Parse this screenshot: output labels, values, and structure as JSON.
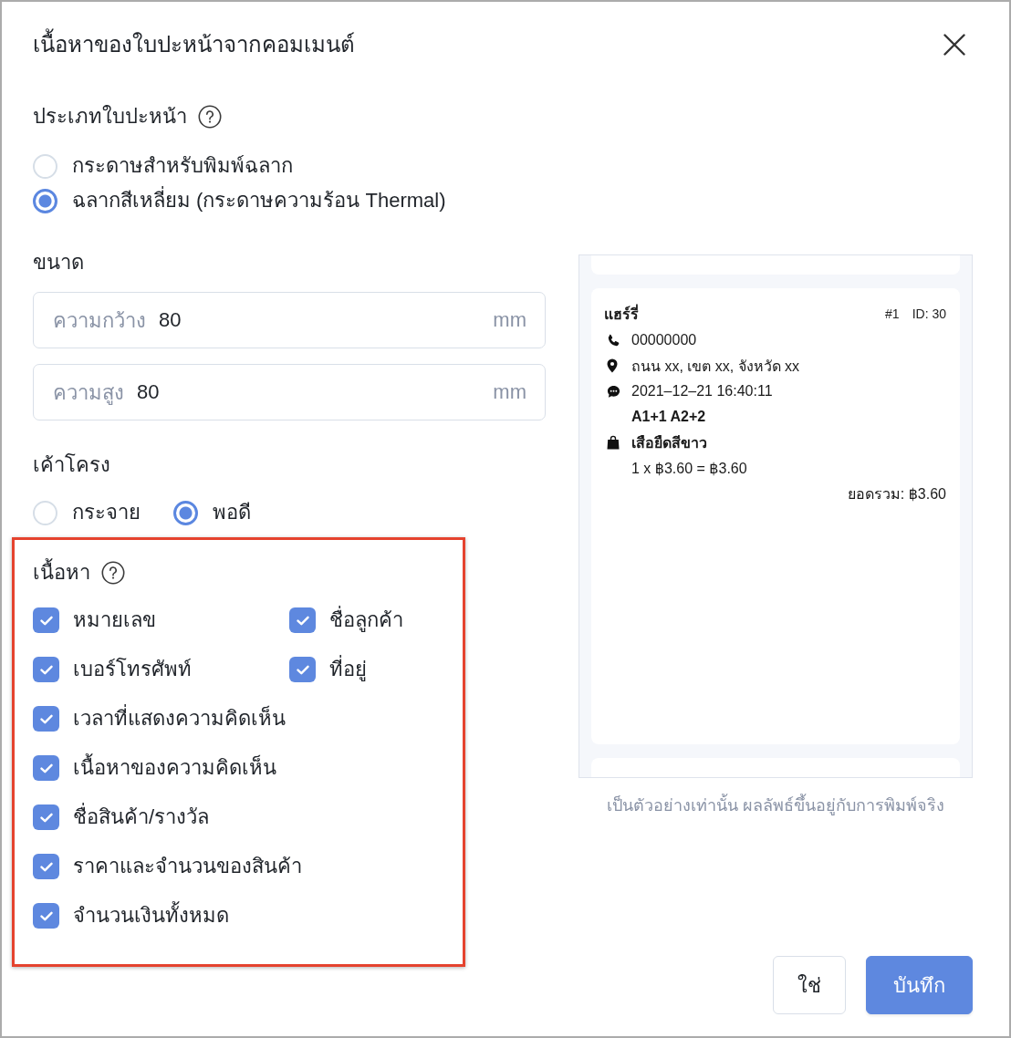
{
  "dialog": {
    "title": "เนื้อหาของใบปะหน้าจากคอมเมนต์"
  },
  "paper_type": {
    "label": "ประเภทใบปะหน้า",
    "help": true,
    "options": [
      {
        "label": "กระดาษสำหรับพิมพ์ฉลาก",
        "selected": false
      },
      {
        "label": "ฉลากสีเหลี่ยม (กระดาษความร้อน Thermal)",
        "selected": true
      }
    ]
  },
  "size": {
    "label": "ขนาด",
    "help": false,
    "fields": [
      {
        "label": "ความกว้าง",
        "value": "80",
        "unit": "mm"
      },
      {
        "label": "ความสูง",
        "value": "80",
        "unit": "mm"
      }
    ]
  },
  "layout": {
    "label": "เค้าโครง",
    "help": false,
    "options": [
      {
        "label": "กระจาย",
        "selected": false
      },
      {
        "label": "พอดี",
        "selected": true
      }
    ]
  },
  "content": {
    "label": "เนื้อหา",
    "help": true,
    "highlighted": true,
    "rows": [
      [
        {
          "label": "หมายเลข",
          "checked": true
        },
        {
          "label": "ชื่อลูกค้า",
          "checked": true
        }
      ],
      [
        {
          "label": "เบอร์โทรศัพท์",
          "checked": true
        },
        {
          "label": "ที่อยู่",
          "checked": true
        }
      ],
      [
        {
          "label": "เวลาที่แสดงความคิดเห็น",
          "checked": true
        }
      ],
      [
        {
          "label": "เนื้อหาของความคิดเห็น",
          "checked": true
        }
      ],
      [
        {
          "label": "ชื่อสินค้า/รางวัล",
          "checked": true
        }
      ],
      [
        {
          "label": "ราคาและจำนวนของสินค้า",
          "checked": true
        }
      ],
      [
        {
          "label": "จำนวนเงินทั้งหมด",
          "checked": true
        }
      ]
    ]
  },
  "preview": {
    "card": {
      "name": "แฮร์รี่",
      "number": "#1",
      "id": "ID: 30",
      "lines": [
        {
          "kind": "phone",
          "text": "00000000"
        },
        {
          "kind": "address",
          "text": "ถนน xx, เขต xx, จังหวัด xx"
        },
        {
          "kind": "comment_time",
          "text": "2021–12–21 16:40:11"
        },
        {
          "kind": "comment",
          "text": "A1+1 A2+2"
        },
        {
          "kind": "product",
          "text": "เสือยืดสีขาว"
        },
        {
          "kind": "price",
          "text": "1 x ฿3.60 = ฿3.60"
        },
        {
          "kind": "total",
          "text": "ยอดรวม: ฿3.60"
        }
      ]
    },
    "note": "เป็นตัวอย่างเท่านั้น ผลลัพธ์ขึ้นอยู่กับการพิมพ์จริง"
  },
  "buttons": [
    {
      "label": "ใช่",
      "kind": "confirm"
    },
    {
      "label": "บันทึก",
      "kind": "save"
    }
  ]
}
